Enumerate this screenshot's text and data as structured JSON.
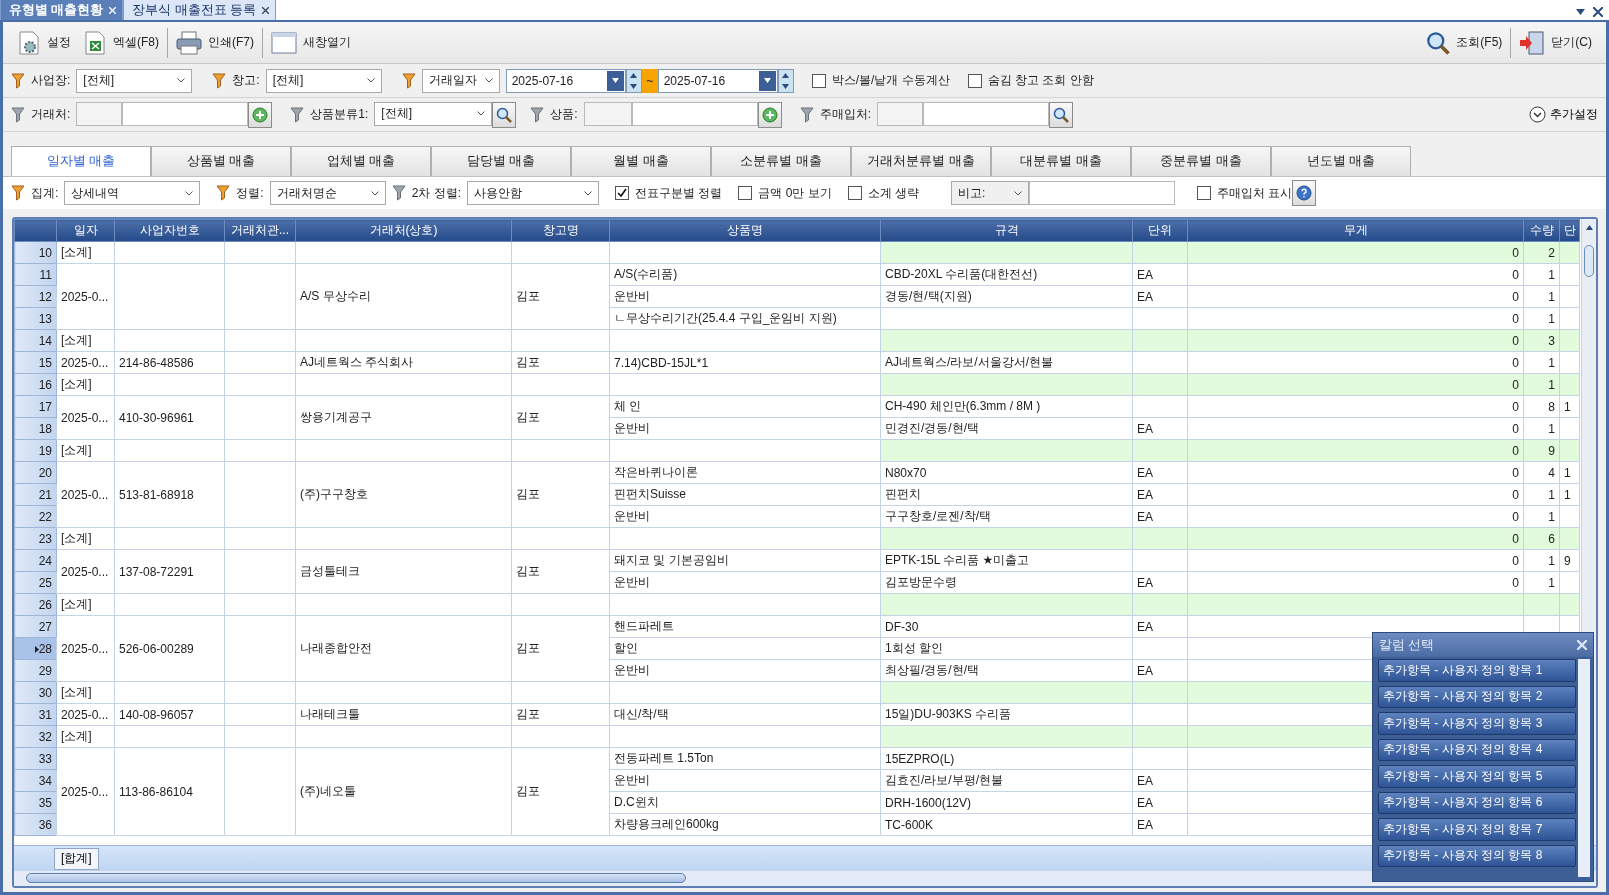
{
  "doc_tabs": [
    {
      "label": "유형별 매출현황",
      "selected": true
    },
    {
      "label": "장부식 매출전표 등록",
      "selected": false
    }
  ],
  "toolbar": {
    "left": [
      {
        "label": "설정",
        "kind": "settings"
      },
      {
        "label": "엑셀(F8)",
        "kind": "excel"
      },
      {
        "label": "인쇄(F7)",
        "kind": "print"
      },
      {
        "label": "새창열기",
        "kind": "window"
      }
    ],
    "right": [
      {
        "label": "조회(F5)",
        "kind": "search"
      },
      {
        "label": "닫기(C)",
        "kind": "exit"
      }
    ]
  },
  "filters": {
    "site": {
      "label": "사업장:",
      "value": "[전체]",
      "active": true
    },
    "warehouse": {
      "label": "창고:",
      "value": "[전체]",
      "active": true
    },
    "date": {
      "type": "거래일자",
      "active": true,
      "from": "2025-07-16",
      "separator": "~",
      "to": "2025-07-16"
    },
    "options": [
      {
        "label": "박스/볼/낱개 수동계산",
        "checked": false
      },
      {
        "label": "숨김 창고 조회 안함",
        "checked": false
      }
    ],
    "client": {
      "label": "거래처:",
      "active": false
    },
    "category": {
      "label": "상품분류1:",
      "value": "[전체]",
      "active": false
    },
    "product": {
      "label": "상품:",
      "active": false
    },
    "buyer": {
      "label": "주매입처:",
      "active": false
    },
    "more": {
      "label": "추가설정"
    }
  },
  "tabs": [
    {
      "label": "일자별 매출",
      "selected": true
    },
    {
      "label": "상품별 매출",
      "selected": false
    },
    {
      "label": "업체별 매출",
      "selected": false
    },
    {
      "label": "담당별 매출",
      "selected": false
    },
    {
      "label": "월별 매출",
      "selected": false
    },
    {
      "label": "소분류별 매출",
      "selected": false
    },
    {
      "label": "거래처분류별 매출",
      "selected": false
    },
    {
      "label": "대분류별 매출",
      "selected": false
    },
    {
      "label": "중분류별 매출",
      "selected": false
    },
    {
      "label": "년도별 매출",
      "selected": false
    }
  ],
  "view": {
    "summary": {
      "label": "집계:",
      "value": "상세내역",
      "active": true
    },
    "sort": {
      "label": "정렬:",
      "value": "거래처명순",
      "active": true
    },
    "sort2": {
      "label": "2차 정렬:",
      "value": "사용안함",
      "active": false
    },
    "checks": [
      {
        "label": "전표구분별 정렬",
        "checked": true
      },
      {
        "label": "금액 0만 보기",
        "checked": false
      },
      {
        "label": "소계 생략",
        "checked": false
      }
    ],
    "note": {
      "value": "비고:"
    },
    "buyer_show": {
      "label": "주매입처 표시",
      "checked": false
    }
  },
  "table": {
    "columns": [
      "일자",
      "사업자번호",
      "거래처관...",
      "거래처(상호)",
      "창고명",
      "상품명",
      "규격",
      "단위",
      "무게",
      "수량",
      "단"
    ],
    "groups": [
      {
        "kind": "subtotal",
        "num": "10",
        "label": "[소계]",
        "weight": "0",
        "qty": "2"
      },
      {
        "kind": "detail",
        "date": "2025-0...",
        "client": "A/S 무상수리",
        "warehouse": "김포",
        "lines": [
          {
            "num": "11",
            "current": false,
            "product": "A/S(수리품)",
            "spec": "CBD-20XL 수리품(대한전선)",
            "unit": "EA",
            "weight": "0",
            "qty": "1"
          },
          {
            "num": "12",
            "current": false,
            "product": "운반비",
            "spec": "경동/현/택(지원)",
            "unit": "EA",
            "weight": "0",
            "qty": "1"
          },
          {
            "num": "13",
            "current": false,
            "product": "ㄴ무상수리기간(25.4.4 구입_운임비 지원)",
            "weight": "0",
            "qty": "1"
          }
        ]
      },
      {
        "kind": "subtotal",
        "num": "14",
        "label": "[소계]",
        "weight": "0",
        "qty": "3"
      },
      {
        "kind": "detail",
        "date": "2025-0...",
        "biz_no": "214-86-48586",
        "client": "AJ네트웍스 주식회사",
        "warehouse": "김포",
        "lines": [
          {
            "num": "15",
            "current": false,
            "product": "7.14)CBD-15JL*1",
            "spec": "AJ네트웍스/라보/서울강서/현불",
            "weight": "0",
            "qty": "1"
          }
        ]
      },
      {
        "kind": "subtotal",
        "num": "16",
        "label": "[소계]",
        "weight": "0",
        "qty": "1"
      },
      {
        "kind": "detail",
        "date": "2025-0...",
        "biz_no": "410-30-96961",
        "client": "쌍용기계공구",
        "warehouse": "김포",
        "lines": [
          {
            "num": "17",
            "current": false,
            "product": "체 인",
            "spec": "CH-490 체인만(6.3mm / 8M )",
            "weight": "0",
            "qty": "8",
            "column_12": "1"
          },
          {
            "num": "18",
            "current": false,
            "product": "운반비",
            "spec": "민경진/경동/현/택",
            "unit": "EA",
            "weight": "0",
            "qty": "1"
          }
        ]
      },
      {
        "kind": "subtotal",
        "num": "19",
        "label": "[소계]",
        "weight": "0",
        "qty": "9"
      },
      {
        "kind": "detail",
        "date": "2025-0...",
        "biz_no": "513-81-68918",
        "client": "(주)구구창호",
        "warehouse": "김포",
        "lines": [
          {
            "num": "20",
            "current": false,
            "product": "작은바퀴나이론",
            "spec": "N80x70",
            "unit": "EA",
            "weight": "0",
            "qty": "4",
            "column_12": "1"
          },
          {
            "num": "21",
            "current": false,
            "product": "핀펀치Suisse",
            "spec": "핀펀치",
            "unit": "EA",
            "weight": "0",
            "qty": "1",
            "column_12": "1"
          },
          {
            "num": "22",
            "current": false,
            "product": "운반비",
            "spec": "구구창호/로젠/착/택",
            "unit": "EA",
            "weight": "0",
            "qty": "1"
          }
        ]
      },
      {
        "kind": "subtotal",
        "num": "23",
        "label": "[소계]",
        "weight": "0",
        "qty": "6"
      },
      {
        "kind": "detail",
        "date": "2025-0...",
        "biz_no": "137-08-72291",
        "client": "금성툴테크",
        "warehouse": "김포",
        "lines": [
          {
            "num": "24",
            "current": false,
            "product": "돼지코 및 기본공임비",
            "spec": "EPTK-15L 수리품  ★미출고",
            "weight": "0",
            "qty": "1",
            "column_12": "9"
          },
          {
            "num": "25",
            "current": false,
            "product": "운반비",
            "spec": "김포방문수령",
            "unit": "EA",
            "weight": "0",
            "qty": "1"
          }
        ]
      },
      {
        "kind": "subtotal",
        "num": "26",
        "label": "[소계]"
      },
      {
        "kind": "detail",
        "date": "2025-0...",
        "biz_no": "526-06-00289",
        "client": "나래종합안전",
        "warehouse": "김포",
        "lines": [
          {
            "num": "27",
            "current": false,
            "product": "핸드파레트",
            "spec": "DF-30",
            "unit": "EA"
          },
          {
            "num": "28",
            "current": true,
            "product": "할인",
            "spec": "1회성 할인"
          },
          {
            "num": "29",
            "current": false,
            "product": "운반비",
            "spec": "최상필/경동/현/택",
            "unit": "EA"
          }
        ]
      },
      {
        "kind": "subtotal",
        "num": "30",
        "label": "[소계]"
      },
      {
        "kind": "detail",
        "date": "2025-0...",
        "biz_no": "140-08-96057",
        "client": "나래테크툴",
        "warehouse": "김포",
        "lines": [
          {
            "num": "31",
            "current": false,
            "product": "대신/착/택",
            "spec": "15일)DU-903KS 수리품"
          }
        ]
      },
      {
        "kind": "subtotal",
        "num": "32",
        "label": "[소계]"
      },
      {
        "kind": "detail",
        "date": "2025-0...",
        "biz_no": "113-86-86104",
        "client": "(주)네오툴",
        "warehouse": "김포",
        "lines": [
          {
            "num": "33",
            "current": false,
            "product": "전동파레트 1.5Ton",
            "spec": "15EZPRO(L)"
          },
          {
            "num": "34",
            "current": false,
            "product": "운반비",
            "spec": "김효진/라보/부평/현불",
            "unit": "EA"
          },
          {
            "num": "35",
            "current": false,
            "product": "D.C윈치",
            "spec": "DRH-1600(12V)",
            "unit": "EA"
          },
          {
            "num": "36",
            "current": false,
            "product": "차량용크레인600kg",
            "spec": "TC-600K",
            "unit": "EA"
          }
        ]
      }
    ],
    "footer": {
      "total": "[합계]"
    }
  },
  "column_picker": {
    "title": "칼럼 선택",
    "items": [
      "추가항목 - 사용자 정의 항목 1",
      "추가항목 - 사용자 정의 항목 2",
      "추가항목 - 사용자 정의 항목 3",
      "추가항목 - 사용자 정의 항목 4",
      "추가항목 - 사용자 정의 항목 5",
      "추가항목 - 사용자 정의 항목 6",
      "추가항목 - 사용자 정의 항목 7",
      "추가항목 - 사용자 정의 항목 8"
    ]
  }
}
